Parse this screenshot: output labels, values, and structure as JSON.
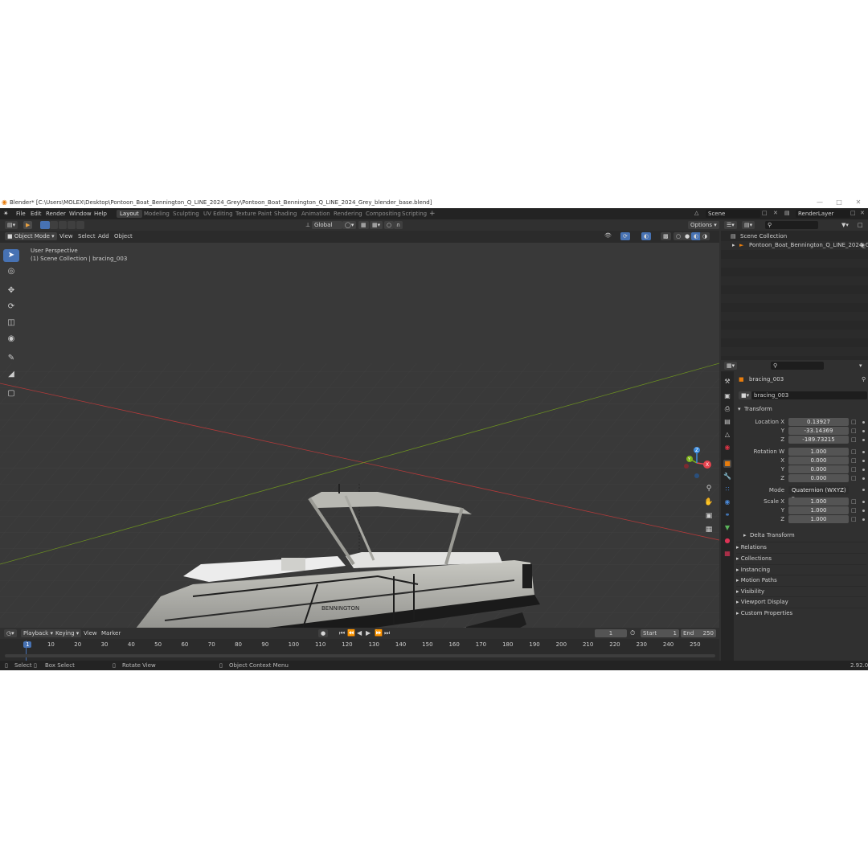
{
  "window": {
    "title": "Blender* [C:\\Users\\MOLEX\\Desktop\\Pontoon_Boat_Bennington_Q_LINE_2024_Grey\\Pontoon_Boat_Bennington_Q_LINE_2024_Grey_blender_base.blend]"
  },
  "menu": [
    "File",
    "Edit",
    "Render",
    "Window",
    "Help"
  ],
  "workspaces": [
    "Layout",
    "Modeling",
    "Sculpting",
    "UV Editing",
    "Texture Paint",
    "Shading",
    "Animation",
    "Rendering",
    "Compositing",
    "Scripting"
  ],
  "active_workspace": "Layout",
  "scene": {
    "scene_name": "Scene",
    "view_layer": "RenderLayer"
  },
  "tool_header": {
    "transform_orientation": "Global",
    "options_label": "Options"
  },
  "viewport_header": {
    "mode": "Object Mode",
    "menus": [
      "View",
      "Select",
      "Add",
      "Object"
    ]
  },
  "viewport": {
    "perspective_label": "User Perspective",
    "collection_label": "(1) Scene Collection | bracing_003",
    "gizmo": {
      "x": "X",
      "y": "Y",
      "z": "Z"
    },
    "boat_brand": "BENNINGTON"
  },
  "outliner": {
    "root": "Scene Collection",
    "items": [
      "Pontoon_Boat_Bennington_Q_LINE_2024_Gr"
    ]
  },
  "properties": {
    "object_name": "bracing_003",
    "data_name": "bracing_003",
    "transform_title": "Transform",
    "location": {
      "label_x": "Location X",
      "label_y": "Y",
      "label_z": "Z",
      "x": "0.13927",
      "y": "-33.14369",
      "z": "-189.73215"
    },
    "rotation": {
      "label_w": "Rotation W",
      "label_x": "X",
      "label_y": "Y",
      "label_z": "Z",
      "w": "1.000",
      "x": "0.000",
      "y": "0.000",
      "z": "0.000"
    },
    "mode": {
      "label": "Mode",
      "value": "Quaternion (WXYZ)"
    },
    "scale": {
      "label_x": "Scale X",
      "label_y": "Y",
      "label_z": "Z",
      "x": "1.000",
      "y": "1.000",
      "z": "1.000"
    },
    "delta_transform": "Delta Transform",
    "panels": [
      "Relations",
      "Collections",
      "Instancing",
      "Motion Paths",
      "Visibility",
      "Viewport Display",
      "Custom Properties"
    ]
  },
  "timeline": {
    "menus": [
      "Playback",
      "Keying",
      "View",
      "Marker"
    ],
    "current_frame": "1",
    "start_label": "Start",
    "start": "1",
    "end_label": "End",
    "end": "250",
    "ruler": [
      "1",
      "10",
      "20",
      "30",
      "40",
      "50",
      "60",
      "70",
      "80",
      "90",
      "100",
      "110",
      "120",
      "130",
      "140",
      "150",
      "160",
      "170",
      "180",
      "190",
      "200",
      "210",
      "220",
      "230",
      "240",
      "250"
    ]
  },
  "statusbar": {
    "select": "Select",
    "box_select": "Box Select",
    "rotate_view": "Rotate View",
    "context_menu": "Object Context Menu",
    "version": "2.92.0"
  },
  "colors": {
    "accent": "#4772b3",
    "x_axis": "#e5434e",
    "y_axis": "#7fb51a",
    "z_axis": "#3c8cde",
    "blender_orange": "#e87d0d"
  }
}
